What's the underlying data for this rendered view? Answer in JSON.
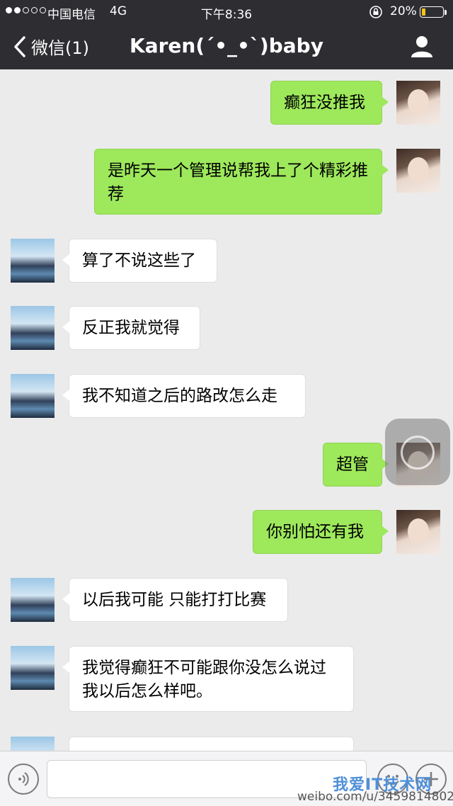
{
  "status_bar": {
    "carrier": "中国电信",
    "network": "4G",
    "time": "下午8:36",
    "battery": "20%",
    "battery_level": 0.2
  },
  "nav": {
    "back_label": "微信(1)",
    "title": "Karen(ˊ•_•ˋ)baby"
  },
  "messages": [
    {
      "from": "me",
      "text": "癫狂没推我"
    },
    {
      "from": "me",
      "text": "是昨天一个管理说帮我上了个精彩推荐"
    },
    {
      "from": "other",
      "text": "算了不说这些了"
    },
    {
      "from": "other",
      "text": "反正我就觉得"
    },
    {
      "from": "other",
      "text": "我不知道之后的路改怎么走"
    },
    {
      "from": "me",
      "text": "超管"
    },
    {
      "from": "me",
      "text": "你别怕还有我"
    },
    {
      "from": "other",
      "text": "以后我可能 只能打打比赛"
    },
    {
      "from": "other",
      "text": "我觉得癫狂不可能跟你没怎么说过我以后怎么样吧。"
    },
    {
      "from": "other",
      "text": ""
    }
  ],
  "input": {
    "value": "",
    "placeholder": ""
  },
  "icons": {
    "voice": "voice-icon",
    "emoji": "emoji-icon",
    "add": "plus-icon",
    "back": "chevron-left-icon",
    "profile": "person-icon"
  },
  "colors": {
    "topbar": "#2d2d32",
    "bubble_out": "#9ee85c",
    "bubble_in": "#ffffff",
    "chat_bg": "#ebebeb"
  },
  "watermark": {
    "site": "我爱IT技术网",
    "weibo": "weibo.com/u/3459814802"
  }
}
